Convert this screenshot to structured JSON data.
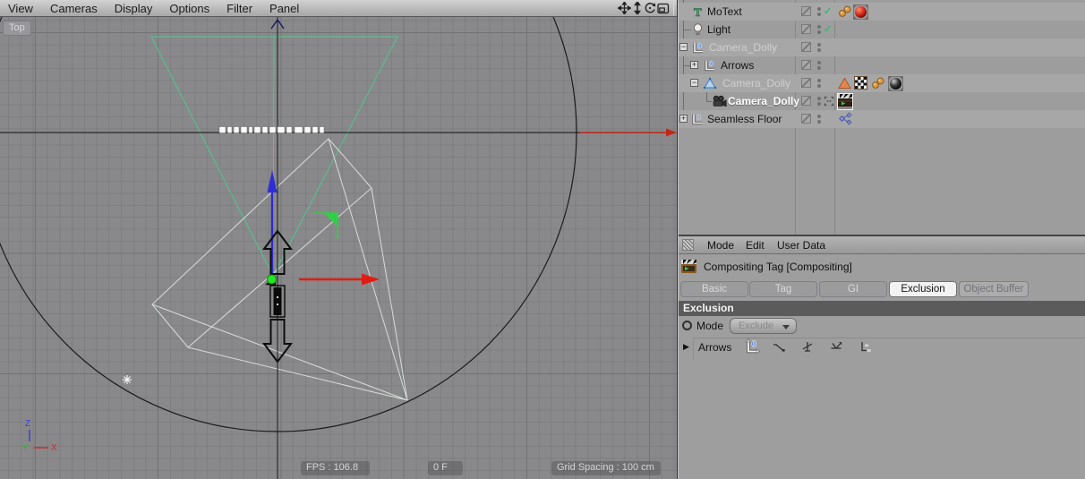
{
  "viewport": {
    "menu": {
      "items": [
        "View",
        "Cameras",
        "Display",
        "Options",
        "Filter",
        "Panel"
      ]
    },
    "view_label": "Top",
    "status": {
      "fps": "FPS : 106.8",
      "frame": "0 F",
      "grid_spacing": "Grid Spacing : 100 cm"
    },
    "gizmo": {
      "x": "X",
      "y": "Y",
      "z": "Z"
    }
  },
  "object_manager": {
    "expander_minus": "−",
    "expander_plus": "+",
    "enabled_check": "✓",
    "rows": [
      {
        "name": "MoText",
        "type": "motext",
        "enabled": true
      },
      {
        "name": "Light",
        "type": "light",
        "enabled": true
      },
      {
        "name": "Camera_Dolly",
        "type": "null",
        "state": "grayed"
      },
      {
        "name": "Arrows",
        "type": "null"
      },
      {
        "name": "Camera_Dolly",
        "type": "rig",
        "state": "grayed"
      },
      {
        "name": "Camera_Dolly",
        "type": "camera",
        "state": "selected"
      },
      {
        "name": "Seamless Floor",
        "type": "null"
      }
    ]
  },
  "attribute_manager": {
    "menu": {
      "items": [
        "Mode",
        "Edit",
        "User Data"
      ]
    },
    "title": "Compositing Tag [Compositing]",
    "tabs": [
      "Basic",
      "Tag",
      "GI",
      "Exclusion",
      "Object Buffer"
    ],
    "active_tab": "Exclusion",
    "section_header": "Exclusion",
    "mode_label": "Mode",
    "mode_value": "Exclude",
    "list": {
      "item_label": "Arrows"
    }
  },
  "colors": {
    "viewport_bg": "#89898b",
    "panel_bg": "#9e9e9e",
    "frustum_green": "#4fc68c",
    "frustum_white": "#d8dcd8",
    "axis_red": "#d42318",
    "axis_blue": "#2b2bd0",
    "origin_green": "#25e625",
    "check_green": "#2fbf6b",
    "section_header_bg": "#5b5b5b",
    "active_tab_bg": "#f2f2f2"
  }
}
